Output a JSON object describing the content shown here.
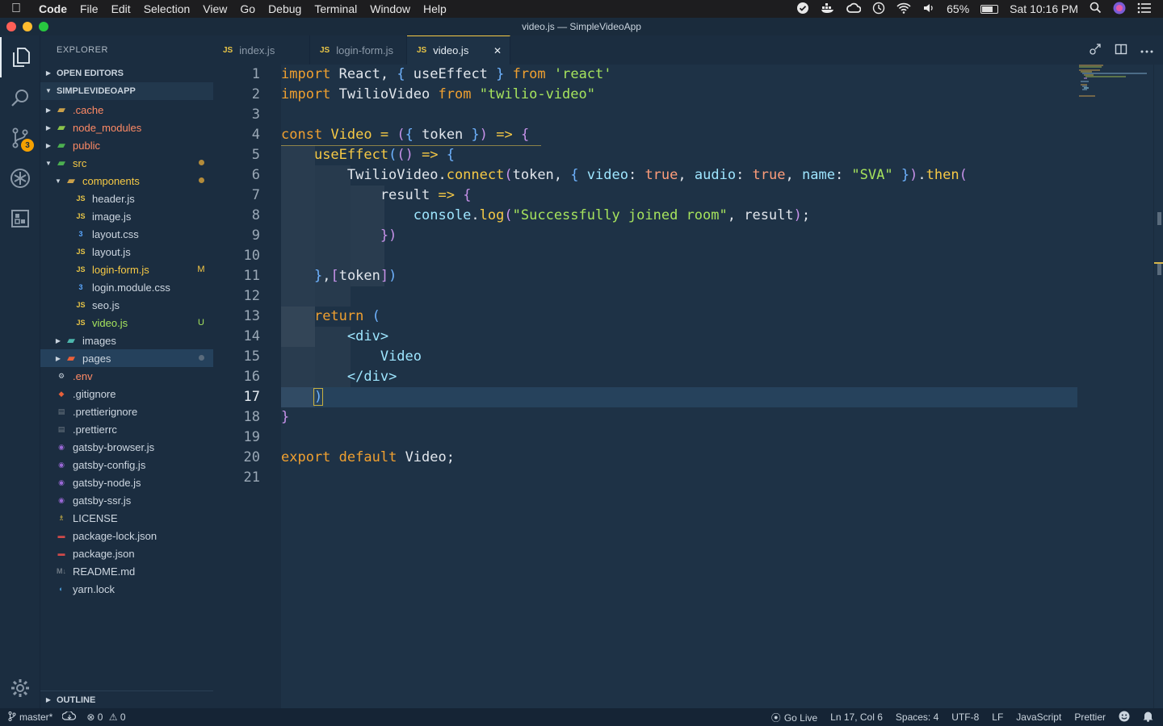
{
  "menubar": {
    "app": "Code",
    "items": [
      "File",
      "Edit",
      "Selection",
      "View",
      "Go",
      "Debug",
      "Terminal",
      "Window",
      "Help"
    ],
    "battery": "65%",
    "clock": "Sat 10:16 PM"
  },
  "window": {
    "title": "video.js — SimpleVideoApp"
  },
  "activity": {
    "scm_badge": "3"
  },
  "sidebar": {
    "title": "EXPLORER",
    "open_editors": "OPEN EDITORS",
    "project": "SIMPLEVIDEOAPP",
    "outline": "OUTLINE",
    "tree": [
      {
        "label": ".cache",
        "color": "#ff8a65",
        "icon": "folder-icon",
        "twisty": "▶",
        "depth": 0
      },
      {
        "label": "node_modules",
        "color": "#ff8a65",
        "icon": "node-folder-icon",
        "twisty": "▶",
        "depth": 0
      },
      {
        "label": "public",
        "color": "#ff8a65",
        "icon": "public-folder-icon",
        "twisty": "▶",
        "depth": 0
      },
      {
        "label": "src",
        "color": "#f6c945",
        "icon": "src-folder-icon",
        "twisty": "▼",
        "depth": 0,
        "dot": "#b38b3a"
      },
      {
        "label": "components",
        "color": "#f6c945",
        "icon": "folder-icon",
        "twisty": "▼",
        "depth": 1,
        "dot": "#b38b3a"
      },
      {
        "label": "header.js",
        "color": "#cdd6e0",
        "icon": "js-file-icon",
        "depth": 2
      },
      {
        "label": "image.js",
        "color": "#cdd6e0",
        "icon": "js-file-icon",
        "depth": 2
      },
      {
        "label": "layout.css",
        "color": "#cdd6e0",
        "icon": "css-file-icon",
        "depth": 2
      },
      {
        "label": "layout.js",
        "color": "#cdd6e0",
        "icon": "js-file-icon",
        "depth": 2
      },
      {
        "label": "login-form.js",
        "color": "#f6c945",
        "icon": "js-file-icon",
        "depth": 2,
        "deco": "M"
      },
      {
        "label": "login.module.css",
        "color": "#cdd6e0",
        "icon": "css-file-icon",
        "depth": 2
      },
      {
        "label": "seo.js",
        "color": "#cdd6e0",
        "icon": "js-file-icon",
        "depth": 2
      },
      {
        "label": "video.js",
        "color": "#a6e35d",
        "icon": "js-file-icon",
        "depth": 2,
        "deco": "U"
      },
      {
        "label": "images",
        "color": "#cdd6e0",
        "icon": "images-folder-icon",
        "twisty": "▶",
        "depth": 1
      },
      {
        "label": "pages",
        "color": "#cdd6e0",
        "icon": "pages-folder-icon",
        "twisty": "▶",
        "depth": 1,
        "dot": "#5a6b7c",
        "selected": true
      },
      {
        "label": ".env",
        "color": "#ff8a65",
        "icon": "gear-file-icon",
        "depth": 0
      },
      {
        "label": ".gitignore",
        "color": "#cdd6e0",
        "icon": "git-file-icon",
        "depth": 0
      },
      {
        "label": ".prettierignore",
        "color": "#cdd6e0",
        "icon": "prettier-file-icon",
        "depth": 0
      },
      {
        "label": ".prettierrc",
        "color": "#cdd6e0",
        "icon": "prettier-file-icon",
        "depth": 0
      },
      {
        "label": "gatsby-browser.js",
        "color": "#cdd6e0",
        "icon": "gatsby-file-icon",
        "depth": 0
      },
      {
        "label": "gatsby-config.js",
        "color": "#cdd6e0",
        "icon": "gatsby-file-icon",
        "depth": 0
      },
      {
        "label": "gatsby-node.js",
        "color": "#cdd6e0",
        "icon": "gatsby-file-icon",
        "depth": 0
      },
      {
        "label": "gatsby-ssr.js",
        "color": "#cdd6e0",
        "icon": "gatsby-file-icon",
        "depth": 0
      },
      {
        "label": "LICENSE",
        "color": "#cdd6e0",
        "icon": "license-file-icon",
        "depth": 0
      },
      {
        "label": "package-lock.json",
        "color": "#cdd6e0",
        "icon": "npm-file-icon",
        "depth": 0
      },
      {
        "label": "package.json",
        "color": "#cdd6e0",
        "icon": "npm-file-icon",
        "depth": 0
      },
      {
        "label": "README.md",
        "color": "#cdd6e0",
        "icon": "markdown-file-icon",
        "depth": 0
      },
      {
        "label": "yarn.lock",
        "color": "#cdd6e0",
        "icon": "yarn-file-icon",
        "depth": 0
      }
    ]
  },
  "tabs": [
    {
      "label": "index.js",
      "active": false
    },
    {
      "label": "login-form.js",
      "active": false
    },
    {
      "label": "video.js",
      "active": true
    }
  ],
  "editor": {
    "line_numbers": [
      "1",
      "2",
      "3",
      "4",
      "5",
      "6",
      "7",
      "8",
      "9",
      "10",
      "11",
      "12",
      "13",
      "14",
      "15",
      "16",
      "17",
      "18",
      "19",
      "20",
      "21"
    ],
    "current_line": 17
  },
  "statusbar": {
    "branch": "master*",
    "errors": "0",
    "warnings": "0",
    "golive": "Go Live",
    "position": "Ln 17, Col 6",
    "spaces": "Spaces: 4",
    "encoding": "UTF-8",
    "eol": "LF",
    "language": "JavaScript",
    "formatter": "Prettier"
  }
}
